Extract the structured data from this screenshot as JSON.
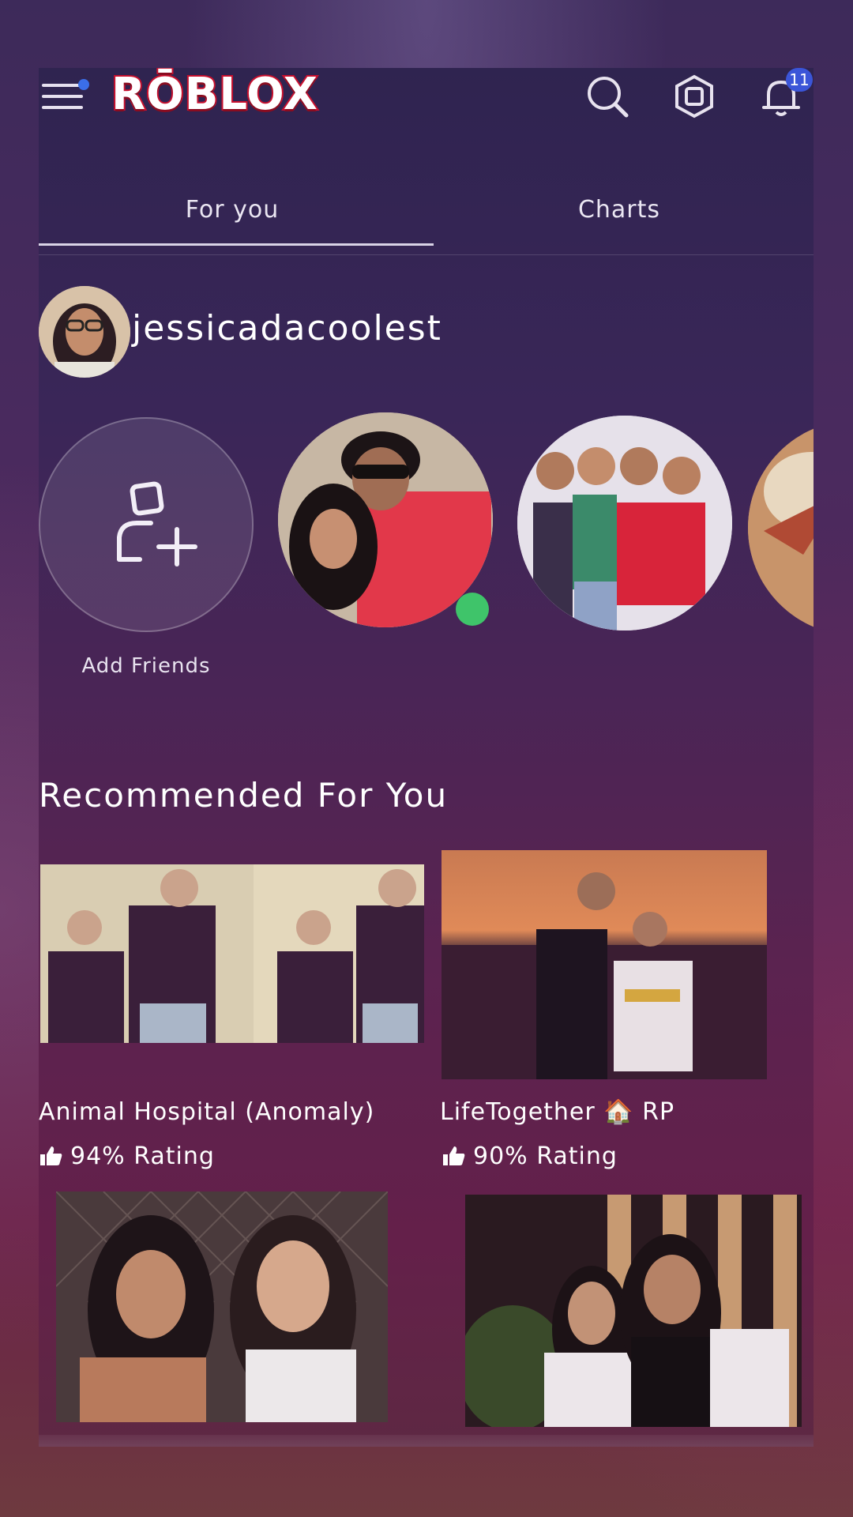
{
  "header": {
    "logo_text": "RŌBLOX",
    "notification_count": "11"
  },
  "tabs": [
    {
      "label": "For you",
      "active": true
    },
    {
      "label": "Charts",
      "active": false
    }
  ],
  "user": {
    "username": "jessicadacoolest"
  },
  "friends": {
    "add_label": "Add Friends"
  },
  "recommended": {
    "title": "Recommended For You",
    "games": [
      {
        "title": "Animal Hospital (Anomaly)",
        "rating": "94% Rating"
      },
      {
        "title": "LifeTogether 🏠 RP",
        "rating": "90% Rating"
      }
    ]
  },
  "colors": {
    "accent": "#3b55d8",
    "online": "#3fc46a",
    "logo_stroke": "#c8102e"
  }
}
